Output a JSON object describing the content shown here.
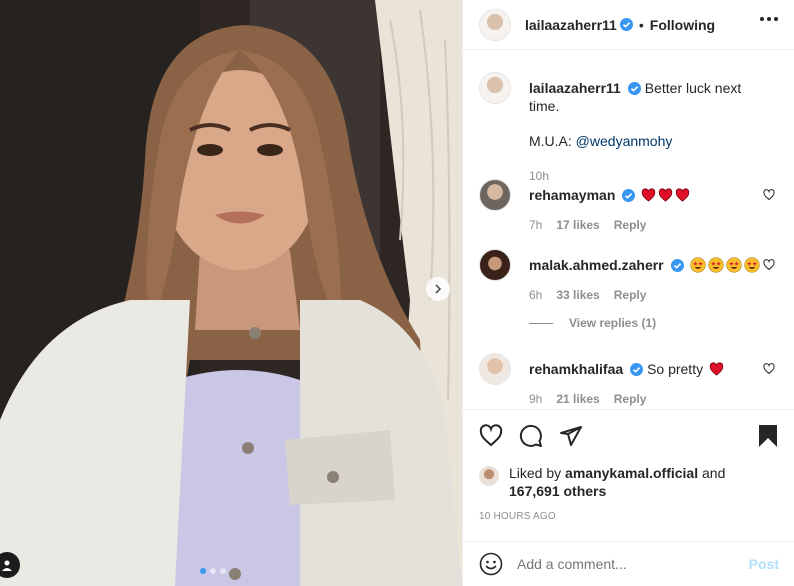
{
  "post": {
    "author": "lailaazaherr11",
    "follow_status": "Following",
    "bullet": "•",
    "caption": "Better luck next time.",
    "caption_credit_label": "M.U.A:",
    "caption_mention": "@wedyanmohy",
    "caption_time": "10h",
    "carousel_dot_count": 3,
    "carousel_active_index": 0
  },
  "comments": [
    {
      "user": "rehamayman",
      "text": "",
      "emoji": "red-heart",
      "emoji_count": 3,
      "time": "7h",
      "likes": "17 likes",
      "reply": "Reply"
    },
    {
      "user": "malak.ahmed.zaherr",
      "text": "",
      "emoji": "star-struck",
      "emoji_count": 4,
      "time": "6h",
      "likes": "33 likes",
      "reply": "Reply",
      "view_replies": "View replies (1)"
    },
    {
      "user": "rehamkhalifaa",
      "text": "So pretty",
      "emoji": "red-heart",
      "emoji_count": 1,
      "time": "9h",
      "likes": "21 likes",
      "reply": "Reply"
    }
  ],
  "likes": {
    "prefix": "Liked by",
    "user": "amanykamal.official",
    "conj": "and",
    "others": "167,691 others"
  },
  "timestamp": "10 HOURS AGO",
  "add_comment": {
    "placeholder": "Add a comment...",
    "post_label": "Post"
  },
  "colors": {
    "verified": "#3897f0",
    "link": "#00376b",
    "muted": "#8e8e8e",
    "heart": "#ed4956",
    "post_disabled": "#b2dffc"
  },
  "icons": [
    "more-options-icon",
    "heart-icon",
    "comment-icon",
    "share-icon",
    "bookmark-icon",
    "emoji-icon",
    "next-icon",
    "user-tag-icon",
    "verified-icon"
  ]
}
